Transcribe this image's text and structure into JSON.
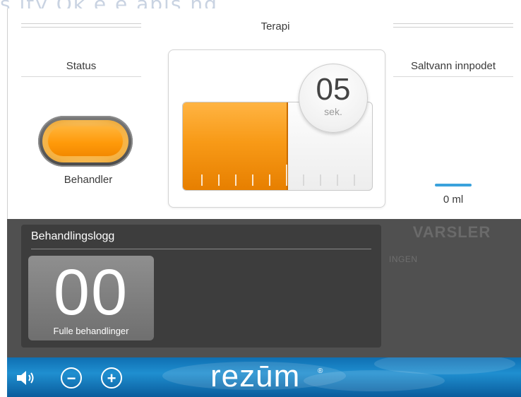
{
  "watermark": "s ity  Ok  e  e apis   ng",
  "therapy": {
    "title": "Terapi",
    "timer_value": "05",
    "timer_unit": "sek.",
    "progress": 0.55,
    "tick_count": 10
  },
  "status": {
    "title": "Status",
    "state_label": "Behandler",
    "indicator_color": "#ff9a0a"
  },
  "saline": {
    "title": "Saltvann innpodet",
    "value": "0 ml",
    "bar_color": "#3aa2dc"
  },
  "log": {
    "title": "Behandlingslogg",
    "count": "00",
    "count_label": "Fulle behandlinger"
  },
  "alerts": {
    "title": "VARSLER",
    "value": "INGEN"
  },
  "footer": {
    "brand": "rezūm",
    "brand_mark": "®",
    "speaker_icon": "speaker-icon",
    "minus_label": "−",
    "plus_label": "+"
  }
}
